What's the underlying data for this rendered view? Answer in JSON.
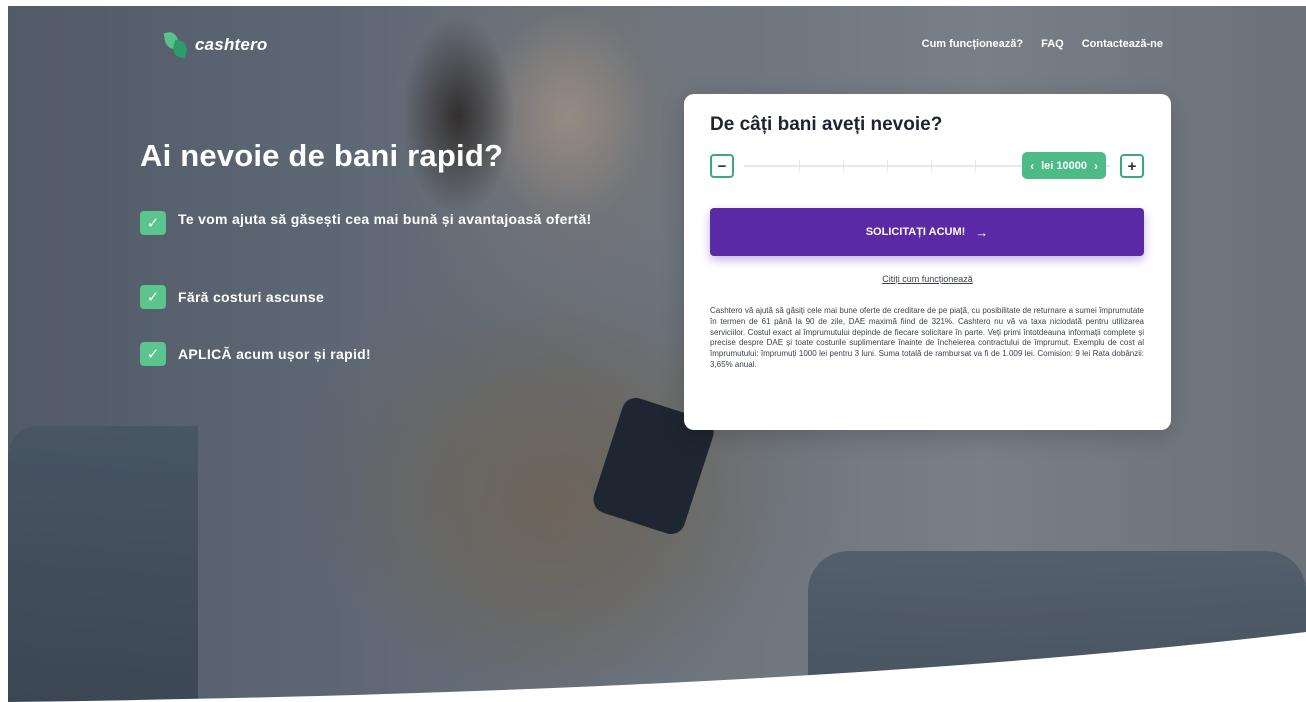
{
  "brand": {
    "name": "cashtero",
    "accent": "#5bc48f",
    "cta_color": "#5a2aa6"
  },
  "nav": {
    "items": [
      {
        "label": "Cum funcționează?"
      },
      {
        "label": "FAQ"
      },
      {
        "label": "Contactează-ne"
      }
    ]
  },
  "hero": {
    "headline": "Ai nevoie de bani rapid?",
    "benefits": [
      {
        "text": "Te vom ajuta să găsești cea mai bună și avantajoasă ofertă!",
        "icon": "check-icon"
      },
      {
        "text": "Fără costuri ascunse",
        "icon": "check-icon"
      },
      {
        "text": "APLICĂ acum ușor și rapid!",
        "icon": "check-icon"
      }
    ]
  },
  "card": {
    "title": "De câți bani aveți nevoie?",
    "amount": {
      "minus_label": "−",
      "plus_label": "+",
      "value_label": "lei 10000",
      "prev_icon": "chevron-left-icon",
      "next_icon": "chevron-right-icon"
    },
    "cta": {
      "label": "SOLICITAȚI ACUM!",
      "icon": "arrow-right-icon"
    },
    "how_link": "Citiți cum funcționează",
    "disclaimer": "Cashtero vă ajută să găsiți cele mai bune oferte de creditare de pe piață, cu posibilitate de returnare a sumei împrumutate în termen de 61 până la 90 de zile, DAE maximă fiind de 321%. Cashtero nu vă va taxa niciodată pentru utilizarea serviciilor. Costul exact al împrumutului depinde de fiecare solicitare în parte. Veți primi întotdeauna informații complete și precise despre DAE și toate costurile suplimentare înainte de încheierea contractului de împrumut. Exemplu de cost al împrumutului: împrumuți 1000 lei pentru 3 luni. Suma totală de rambursat va fi de 1.009 lei. Comision: 9 lei Rata dobânzii: 3,65% anual."
  }
}
